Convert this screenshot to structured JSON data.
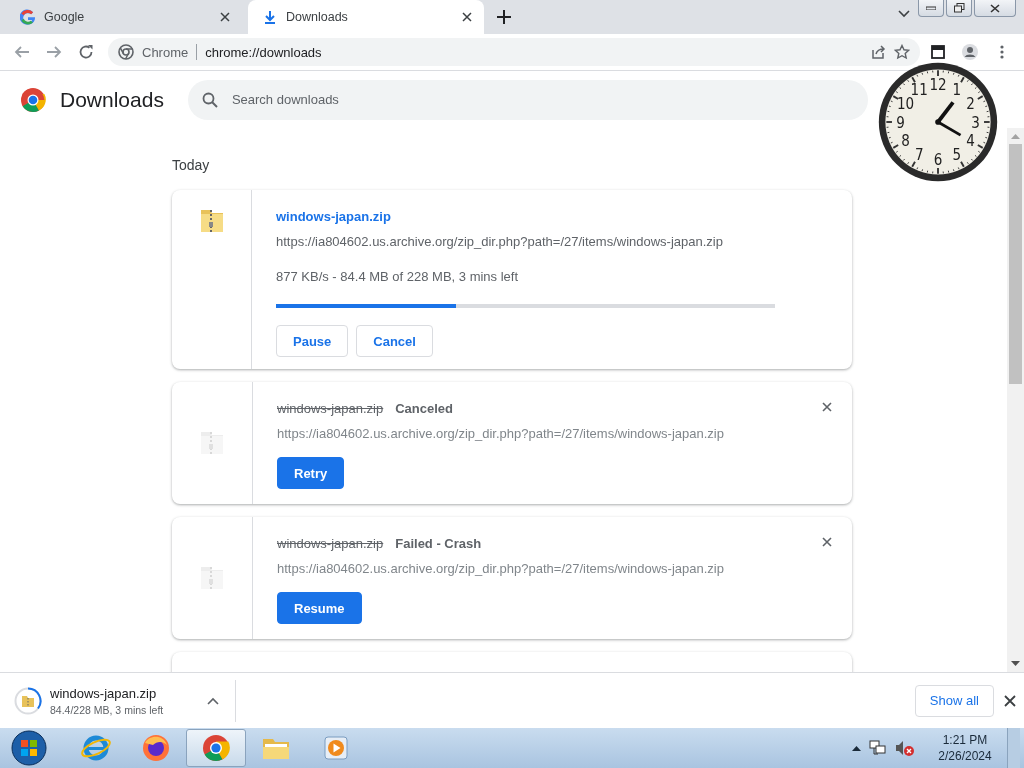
{
  "tabs": [
    {
      "kind": "google",
      "title": "Google",
      "selected": false
    },
    {
      "kind": "download",
      "title": "Downloads",
      "selected": true
    }
  ],
  "toolbar": {
    "site_label": "Chrome",
    "url": "chrome://downloads"
  },
  "page": {
    "title": "Downloads",
    "search": {
      "placeholder": "Search downloads"
    },
    "section": "Today"
  },
  "downloads": [
    {
      "kind": "in_progress",
      "name": "windows-japan.zip",
      "url": "https://ia804602.us.archive.org/zip_dir.php?path=/27/items/windows-japan.zip",
      "status": "877 KB/s - 84.4 MB of 228 MB, 3 mins left",
      "level": 0.36,
      "buttons": [
        {
          "label": "Pause",
          "primary": false
        },
        {
          "label": "Cancel",
          "primary": false
        }
      ]
    },
    {
      "kind": "canceled",
      "name": "windows-japan.zip",
      "state_label": "Canceled",
      "url": "https://ia804602.us.archive.org/zip_dir.php?path=/27/items/windows-japan.zip",
      "buttons": [
        {
          "label": "Retry",
          "primary": true
        }
      ]
    },
    {
      "kind": "failed",
      "name": "windows-japan.zip",
      "state_label": "Failed - Crash",
      "url": "https://ia804602.us.archive.org/zip_dir.php?path=/27/items/windows-japan.zip",
      "buttons": [
        {
          "label": "Resume",
          "primary": true
        }
      ]
    },
    {
      "kind": "hidden"
    }
  ],
  "shelf": {
    "name": "windows-japan.zip",
    "status": "84.4/228 MB, 3 mins left",
    "show_all": "Show all"
  },
  "clock": {
    "numerals": [
      "11",
      "12",
      "1",
      "10",
      "2",
      "9",
      "3",
      "8",
      "4",
      "7",
      "6",
      "5"
    ]
  },
  "taskbar": {
    "apps": [
      {
        "kind": "ie",
        "active": false
      },
      {
        "kind": "firefox",
        "active": false
      },
      {
        "kind": "chrome",
        "active": true
      },
      {
        "kind": "explorer",
        "active": false
      },
      {
        "kind": "media",
        "active": false
      }
    ],
    "time": "1:21 PM",
    "date": "2/26/2024"
  }
}
